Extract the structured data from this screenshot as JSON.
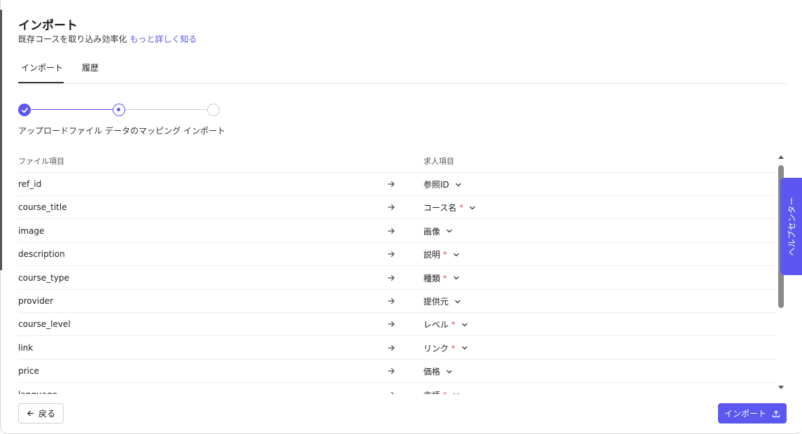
{
  "header": {
    "title": "インポート",
    "subtitle": "既存コースを取り込み効率化",
    "learn_more": "もっと詳しく知る"
  },
  "tabs": [
    {
      "label": "インポート",
      "active": true
    },
    {
      "label": "履歴",
      "active": false
    }
  ],
  "stepper": {
    "steps": [
      "アップロードファイル",
      "データのマッピング",
      "インポート"
    ],
    "current_step": 2
  },
  "table": {
    "col_file": "ファイル項目",
    "col_job": "求人項目",
    "rows": [
      {
        "file": "ref_id",
        "target": "参照ID",
        "required": false
      },
      {
        "file": "course_title",
        "target": "コース名",
        "required": true
      },
      {
        "file": "image",
        "target": "画像",
        "required": false
      },
      {
        "file": "description",
        "target": "説明",
        "required": true
      },
      {
        "file": "course_type",
        "target": "種類",
        "required": true
      },
      {
        "file": "provider",
        "target": "提供元",
        "required": false
      },
      {
        "file": "course_level",
        "target": "レベル",
        "required": true
      },
      {
        "file": "link",
        "target": "リンク",
        "required": true
      },
      {
        "file": "price",
        "target": "価格",
        "required": false
      },
      {
        "file": "language",
        "target": "言語",
        "required": true
      }
    ]
  },
  "help_center": "ヘルプセンター",
  "footer": {
    "back_label": "戻る",
    "import_label": "インポート"
  },
  "colors": {
    "accent": "#5b57f0",
    "required": "#e53935"
  }
}
